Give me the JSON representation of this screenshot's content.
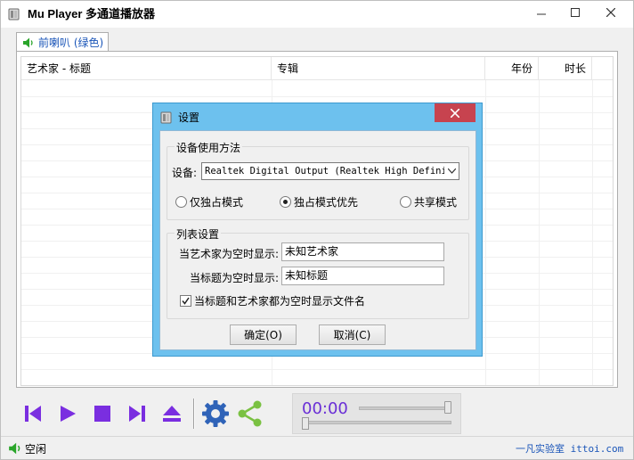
{
  "window": {
    "title": "Mu Player 多通道播放器",
    "minimize_icon": "minimize-icon",
    "maximize_icon": "maximize-icon",
    "close_icon": "close-icon"
  },
  "tab": {
    "label": "前喇叭 (绿色)",
    "icon": "speaker-icon",
    "icon_color": "#2aa52a"
  },
  "list": {
    "columns": [
      "艺术家 - 标题",
      "专辑",
      "年份",
      "时长"
    ]
  },
  "toolbar": {
    "accent_color": "#7a2ee0",
    "buttons": [
      "prev-icon",
      "play-icon",
      "stop-icon",
      "next-icon",
      "eject-icon",
      "gear-icon",
      "share-icon"
    ],
    "time": "00:00",
    "volume_fraction": 1.0,
    "seek_fraction": 0.0
  },
  "status": {
    "text": "空闲",
    "link": "一凡实验室 ittoi.com"
  },
  "dialog": {
    "title": "设置",
    "device_group": {
      "title": "设备使用方法",
      "device_label": "设备:",
      "device_value": "Realtek Digital Output (Realtek High Definit:",
      "modes": [
        {
          "label": "仅独占模式",
          "selected": false
        },
        {
          "label": "独占模式优先",
          "selected": true
        },
        {
          "label": "共享模式",
          "selected": false
        }
      ]
    },
    "list_group": {
      "title": "列表设置",
      "artist_label": "当艺术家为空时显示:",
      "artist_value": "未知艺术家",
      "title_label": "当标题为空时显示:",
      "title_value": "未知标题",
      "filename_checkbox": "当标题和艺术家都为空时显示文件名",
      "filename_checked": true
    },
    "ok": "确定(O)",
    "cancel": "取消(C)"
  },
  "colors": {
    "dialog_frame": "#6dc1ee",
    "close_red": "#c7434f",
    "link_blue": "#1a55b8"
  }
}
